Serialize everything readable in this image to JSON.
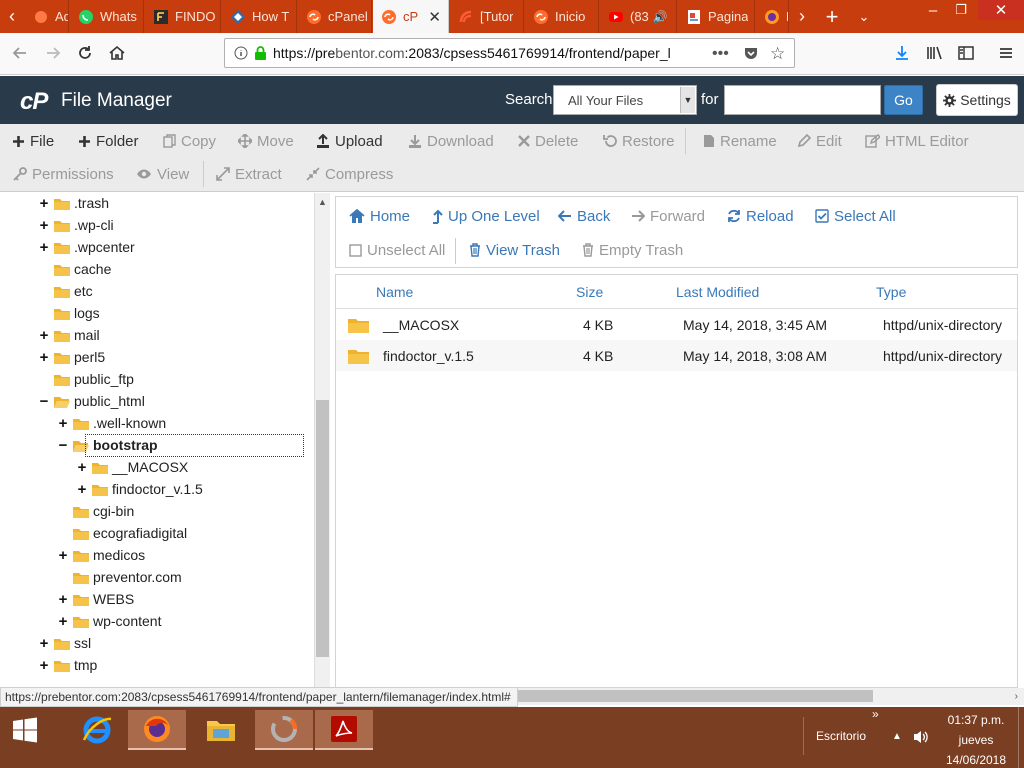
{
  "browser": {
    "tabs": [
      {
        "label": "Admin",
        "icon": "admin-favicon",
        "active": false
      },
      {
        "label": "Whats",
        "icon": "whatsapp-favicon",
        "active": false
      },
      {
        "label": "FINDO",
        "icon": "findo-favicon",
        "active": false
      },
      {
        "label": "How T",
        "icon": "diamond-favicon",
        "active": false
      },
      {
        "label": "cPanel",
        "icon": "cpanel-favicon",
        "active": false
      },
      {
        "label": "cP",
        "icon": "cpanel-favicon",
        "active": true
      },
      {
        "label": "[Tutor",
        "icon": "tutorial-favicon",
        "active": false
      },
      {
        "label": "Inicio",
        "icon": "cpanel-favicon",
        "active": false
      },
      {
        "label": "(83",
        "icon": "youtube-favicon",
        "active": false
      },
      {
        "label": "Pagina",
        "icon": "page-favicon",
        "active": false
      },
      {
        "label": "N",
        "icon": "firefox-favicon",
        "active": false
      }
    ],
    "url": {
      "prefix": "https://pre",
      "host": "bentor.com",
      "rest": ":2083/cpsess5461769914/frontend/paper_l"
    }
  },
  "cpanel": {
    "logo": "cP",
    "title": "File Manager",
    "search_label": "Search",
    "search_scope": "All Your Files",
    "for_label": "for",
    "search_value": "",
    "go_label": "Go",
    "settings_label": "Settings"
  },
  "toolbar": {
    "row1": [
      {
        "label": "File",
        "icon": "plus-icon",
        "enabled": true
      },
      {
        "label": "Folder",
        "icon": "plus-icon",
        "enabled": true
      },
      {
        "label": "Copy",
        "icon": "copy-icon",
        "enabled": false
      },
      {
        "label": "Move",
        "icon": "move-icon",
        "enabled": false
      },
      {
        "label": "Upload",
        "icon": "upload-icon",
        "enabled": true
      },
      {
        "label": "Download",
        "icon": "download-icon",
        "enabled": false
      },
      {
        "label": "Delete",
        "icon": "times-icon",
        "enabled": false
      },
      {
        "label": "Restore",
        "icon": "undo-icon",
        "enabled": false
      },
      {
        "label": "Rename",
        "icon": "file-icon",
        "enabled": false
      },
      {
        "label": "Edit",
        "icon": "pencil-icon",
        "enabled": false
      },
      {
        "label": "HTML Editor",
        "icon": "html-editor-icon",
        "enabled": false
      }
    ],
    "row2": [
      {
        "label": "Permissions",
        "icon": "key-icon",
        "enabled": false
      },
      {
        "label": "View",
        "icon": "eye-icon",
        "enabled": false
      },
      {
        "label": "Extract",
        "icon": "expand-icon",
        "enabled": false
      },
      {
        "label": "Compress",
        "icon": "compress-icon",
        "enabled": false
      }
    ]
  },
  "tree": [
    {
      "label": ".trash",
      "expander": "+",
      "level": 0
    },
    {
      "label": ".wp-cli",
      "expander": "+",
      "level": 0
    },
    {
      "label": ".wpcenter",
      "expander": "+",
      "level": 0
    },
    {
      "label": "cache",
      "expander": "",
      "level": 0
    },
    {
      "label": "etc",
      "expander": "",
      "level": 0
    },
    {
      "label": "logs",
      "expander": "",
      "level": 0
    },
    {
      "label": "mail",
      "expander": "+",
      "level": 0
    },
    {
      "label": "perl5",
      "expander": "+",
      "level": 0
    },
    {
      "label": "public_ftp",
      "expander": "",
      "level": 0
    },
    {
      "label": "public_html",
      "expander": "−",
      "level": 0
    },
    {
      "label": ".well-known",
      "expander": "+",
      "level": 1
    },
    {
      "label": "bootstrap",
      "expander": "−",
      "level": 1,
      "selected": true
    },
    {
      "label": "__MACOSX",
      "expander": "+",
      "level": 2
    },
    {
      "label": "findoctor_v.1.5",
      "expander": "+",
      "level": 2
    },
    {
      "label": "cgi-bin",
      "expander": "",
      "level": 1
    },
    {
      "label": "ecografiadigital",
      "expander": "",
      "level": 1
    },
    {
      "label": "medicos",
      "expander": "+",
      "level": 1
    },
    {
      "label": "preventor.com",
      "expander": "",
      "level": 1
    },
    {
      "label": "WEBS",
      "expander": "+",
      "level": 1
    },
    {
      "label": "wp-content",
      "expander": "+",
      "level": 1
    },
    {
      "label": "ssl",
      "expander": "+",
      "level": 0
    },
    {
      "label": "tmp",
      "expander": "+",
      "level": 0
    }
  ],
  "right_nav": {
    "row1": [
      {
        "label": "Home",
        "icon": "home-icon",
        "enabled": true
      },
      {
        "label": "Up One Level",
        "icon": "level-up-icon",
        "enabled": true
      },
      {
        "label": "Back",
        "icon": "arrow-left-icon",
        "enabled": true
      },
      {
        "label": "Forward",
        "icon": "arrow-right-icon",
        "enabled": false
      },
      {
        "label": "Reload",
        "icon": "refresh-icon",
        "enabled": true
      },
      {
        "label": "Select All",
        "icon": "check-square-icon",
        "enabled": true
      }
    ],
    "row2": [
      {
        "label": "Unselect All",
        "icon": "square-icon",
        "enabled": false
      },
      {
        "label": "View Trash",
        "icon": "trash-icon",
        "enabled": true
      },
      {
        "label": "Empty Trash",
        "icon": "trash-icon",
        "enabled": false
      }
    ]
  },
  "files": {
    "columns": [
      "Name",
      "Size",
      "Last Modified",
      "Type"
    ],
    "rows": [
      {
        "name": "__MACOSX",
        "size": "4 KB",
        "modified": "May 14, 2018, 3:45 AM",
        "type": "httpd/unix-directory"
      },
      {
        "name": "findoctor_v.1.5",
        "size": "4 KB",
        "modified": "May 14, 2018, 3:08 AM",
        "type": "httpd/unix-directory"
      }
    ]
  },
  "status_url": "https://prebentor.com:2083/cpsess5461769914/frontend/paper_lantern/filemanager/index.html#",
  "taskbar": {
    "desktop_label": "Escritorio",
    "time": "01:37 p.m.",
    "day": "jueves",
    "date": "14/06/2018"
  },
  "colors": {
    "tab_strip": "#c83d0d",
    "cpanel_header": "#293a4a",
    "link_blue": "#3a78b8",
    "folder": "#f0b330",
    "taskbar": "#7a3e22"
  }
}
